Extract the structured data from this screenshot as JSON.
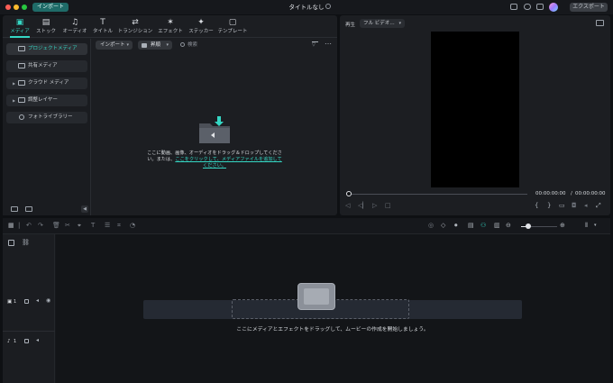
{
  "window": {
    "tab_label": "インポート",
    "title": "タイトルなし",
    "export_label": "エクスポート",
    "traffic_colors": [
      "#ff5f57",
      "#febc2e",
      "#28c840"
    ]
  },
  "categories": [
    {
      "label": "メディア",
      "icon": "media-icon",
      "active": true
    },
    {
      "label": "ストック",
      "icon": "stock-icon"
    },
    {
      "label": "オーディオ",
      "icon": "audio-icon"
    },
    {
      "label": "タイトル",
      "icon": "title-icon"
    },
    {
      "label": "トランジション",
      "icon": "transition-icon"
    },
    {
      "label": "エフェクト",
      "icon": "effect-icon"
    },
    {
      "label": "ステッカー",
      "icon": "sticker-icon"
    },
    {
      "label": "テンプレート",
      "icon": "template-icon"
    }
  ],
  "sidebar": {
    "items": [
      {
        "label": "プロジェクトメディア",
        "active": true
      },
      {
        "label": "共有メディア"
      },
      {
        "label": "クラウド メディア",
        "expandable": true
      },
      {
        "label": "調整レイヤー",
        "expandable": true
      },
      {
        "label": "フォトライブラリー"
      }
    ]
  },
  "media_toolbar": {
    "import_label": "インポート",
    "sort_label": "昇順",
    "search_placeholder": "検索"
  },
  "media_drop": {
    "text": "ここに動画、画像、オーディオをドラッグ＆ドロップしてください。または、",
    "link": "ここをクリックして、メディアファイルを追加してください。"
  },
  "preview": {
    "label": "再生",
    "quality": "フル ビデオ…",
    "time_current": "00:00:00:00",
    "time_separator": "/",
    "time_total": "00:00:00:00"
  },
  "tracks": [
    {
      "type": "video",
      "icon": "video-track-icon",
      "number": "1"
    },
    {
      "type": "audio",
      "icon": "audio-track-icon",
      "number": "1"
    }
  ],
  "timeline": {
    "drop_text": "ここにメディアとエフェクトをドラッグして、ムービーの作成を開始しましょう。",
    "zoom_level": 0.2
  },
  "colors": {
    "accent": "#35d7c4",
    "panel": "#1c1e22",
    "import_tab": "#1f6b68"
  }
}
